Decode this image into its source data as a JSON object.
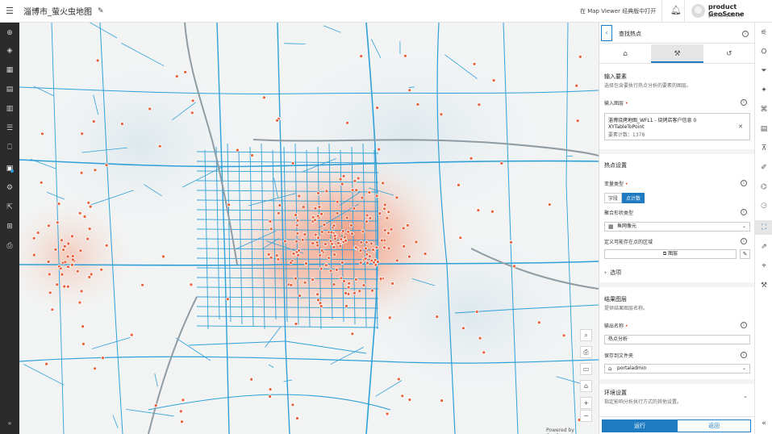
{
  "header": {
    "title": "淄博市_萤火虫地图",
    "open_link": "在 Map Viewer 经典版中打开",
    "user_name": "product GeoScene",
    "user_sub": "portaladmin"
  },
  "left_toolbar": {
    "icons": [
      "add-icon",
      "layers-icon",
      "basemap-icon",
      "table-icon",
      "chart-icon",
      "legend-icon",
      "bookmark-icon",
      "analysis-icon",
      "settings-icon",
      "share-icon",
      "grid-icon",
      "print-icon"
    ],
    "collapse": "»"
  },
  "map": {
    "credit": "Powered by GeoScene",
    "controls": [
      "search-icon",
      "print-icon",
      "screen-icon",
      "home-icon",
      "zoom-in-icon",
      "zoom-out-icon"
    ],
    "zoom_in": "+",
    "zoom_out": "−"
  },
  "panel": {
    "title": "查找热点",
    "tabs": [
      "home-icon",
      "tool-icon",
      "history-icon"
    ],
    "input_section": {
      "title": "输入要素",
      "desc": "选择包含要执行热点分析的要素的图层。",
      "layer_label": "输入图层",
      "layer_line1": "淄博烧烤地图_WFL1 - 烧烤店客户信息 0",
      "layer_line2": "XYTableToPoint",
      "layer_line3": "要素计数：1378"
    },
    "hotspot_section": {
      "title": "热点设置",
      "var_label": "变量类型",
      "var_options": [
        "字段",
        "点计数"
      ],
      "var_selected": "点计数",
      "agg_label": "聚合形状类型",
      "agg_value": "鱼网像元",
      "bound_label": "定义可能存在点的区域",
      "bound_button": "图层",
      "options": "选项"
    },
    "result_section": {
      "title": "结果图层",
      "desc": "提供结果图层名称。",
      "name_label": "输出名称",
      "name_value": "热点分析",
      "folder_label": "保存到文件夹",
      "folder_value": "portaladmin"
    },
    "env_section": {
      "title": "环境设置",
      "desc": "指定影响分析执行方式的其他设置。"
    },
    "buttons": {
      "run": "运行",
      "back": "返回"
    }
  },
  "colors": {
    "accent": "#1f7bc1",
    "road": "#2fa0d8",
    "point": "#e8613c",
    "hotspot": "#f08060"
  }
}
